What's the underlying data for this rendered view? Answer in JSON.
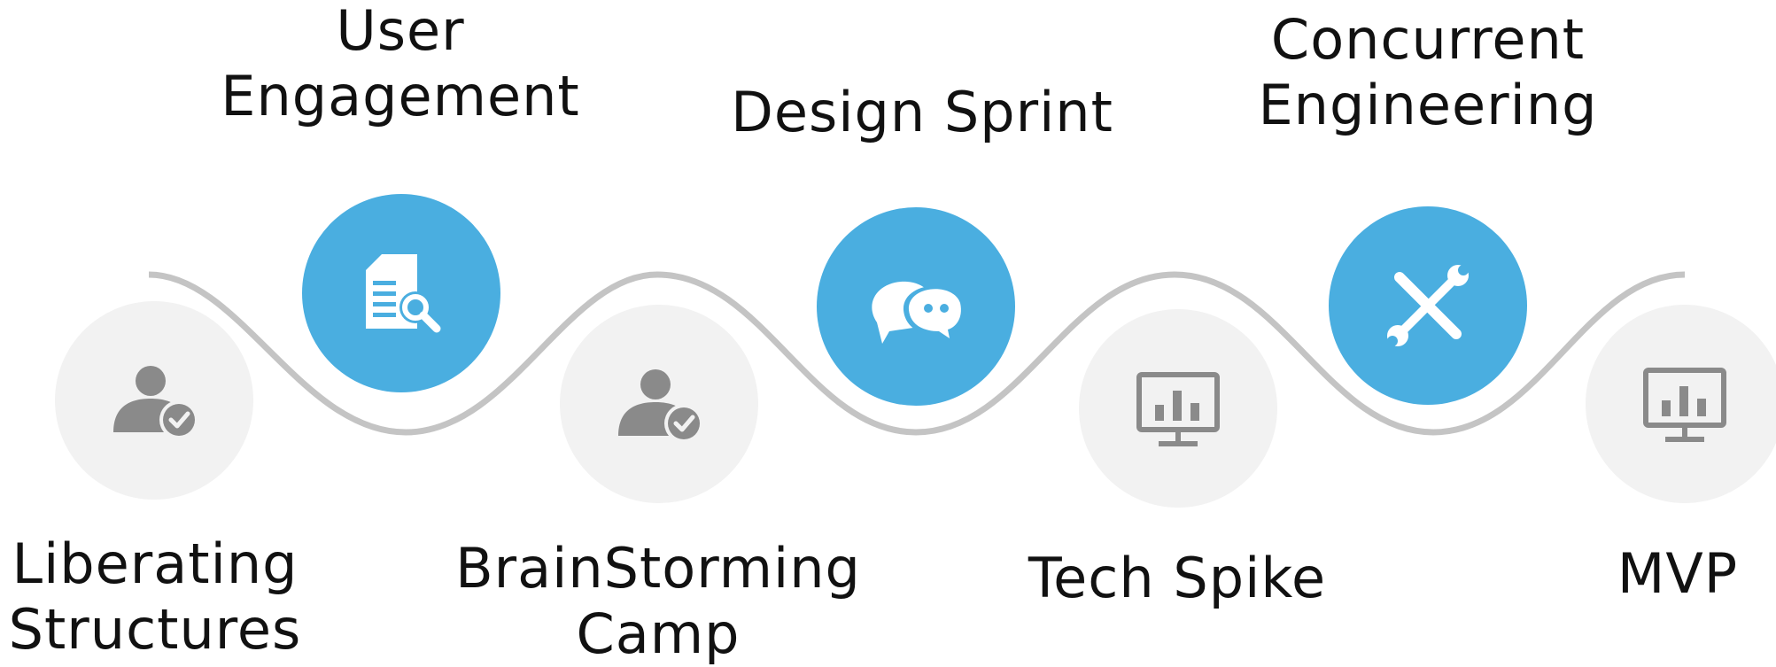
{
  "colors": {
    "accent": "#4aaee0",
    "neutral_circle": "#f2f2f2",
    "neutral_icon": "#8a8a8a",
    "wave": "#c4c4c4",
    "icon_on_accent": "#ffffff"
  },
  "steps": [
    {
      "label": "Liberating\nStructures",
      "icon": "user-check-icon",
      "style": "neutral",
      "position": "low"
    },
    {
      "label": "User\nEngagement",
      "icon": "document-search-icon",
      "style": "accent",
      "position": "high"
    },
    {
      "label": "BrainStorming\nCamp",
      "icon": "user-check-icon",
      "style": "neutral",
      "position": "low"
    },
    {
      "label": "Design Sprint",
      "icon": "chat-bubbles-icon",
      "style": "accent",
      "position": "high"
    },
    {
      "label": "Tech Spike",
      "icon": "monitor-chart-icon",
      "style": "neutral",
      "position": "low"
    },
    {
      "label": "Concurrent\nEngineering",
      "icon": "tools-icon",
      "style": "accent",
      "position": "high"
    },
    {
      "label": "MVP",
      "icon": "monitor-chart-icon",
      "style": "neutral",
      "position": "low"
    }
  ]
}
